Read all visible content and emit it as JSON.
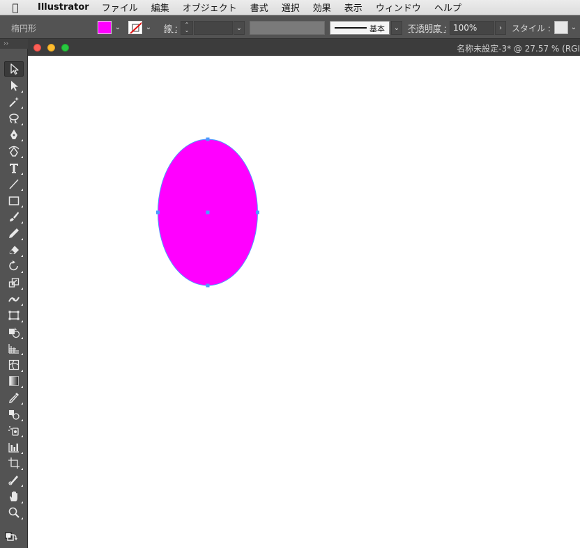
{
  "menubar": {
    "apple_icon": "apple-logo",
    "app_name": "Illustrator",
    "items": [
      "ファイル",
      "編集",
      "オブジェクト",
      "書式",
      "選択",
      "効果",
      "表示",
      "ウィンドウ",
      "ヘルプ"
    ]
  },
  "controlbar": {
    "object_type": "楕円形",
    "fill_color": "#ff00ff",
    "stroke_label": "線 :",
    "stroke_profile_label": "基本",
    "opacity_label": "不透明度 :",
    "opacity_value": "100%",
    "style_label": "スタイル :"
  },
  "document": {
    "title": "名称未設定-3* @ 27.57 % (RGI",
    "panel_grip": "››"
  },
  "artwork": {
    "shape": "ellipse",
    "fill": "#ff00ff",
    "selection_color": "#4d9bff"
  },
  "tools": [
    {
      "name": "selection-tool-icon",
      "active": true
    },
    {
      "name": "direct-selection-tool-icon"
    },
    {
      "name": "magic-wand-tool-icon"
    },
    {
      "name": "lasso-tool-icon"
    },
    {
      "name": "pen-tool-icon"
    },
    {
      "name": "curvature-tool-icon"
    },
    {
      "name": "type-tool-icon"
    },
    {
      "name": "line-segment-tool-icon"
    },
    {
      "name": "rectangle-tool-icon"
    },
    {
      "name": "paintbrush-tool-icon"
    },
    {
      "name": "pencil-tool-icon"
    },
    {
      "name": "eraser-tool-icon"
    },
    {
      "name": "rotate-tool-icon"
    },
    {
      "name": "scale-tool-icon"
    },
    {
      "name": "width-tool-icon"
    },
    {
      "name": "free-transform-tool-icon"
    },
    {
      "name": "shape-builder-tool-icon"
    },
    {
      "name": "perspective-grid-tool-icon"
    },
    {
      "name": "mesh-tool-icon"
    },
    {
      "name": "gradient-tool-icon"
    },
    {
      "name": "eyedropper-tool-icon"
    },
    {
      "name": "blend-tool-icon"
    },
    {
      "name": "symbol-sprayer-tool-icon"
    },
    {
      "name": "column-graph-tool-icon"
    },
    {
      "name": "artboard-tool-icon"
    },
    {
      "name": "slice-tool-icon"
    },
    {
      "name": "hand-tool-icon"
    },
    {
      "name": "zoom-tool-icon"
    },
    {
      "name": "fill-stroke-swap-icon"
    }
  ]
}
